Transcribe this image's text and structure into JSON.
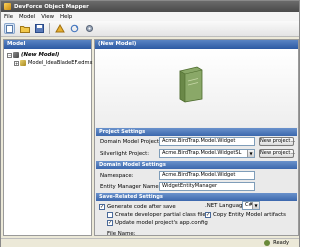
{
  "window": {
    "title": "DevForce Object Mapper"
  },
  "menu": [
    "File",
    "Model",
    "View",
    "Help"
  ],
  "left_panel": {
    "header": "Model",
    "tree": [
      {
        "label": "(New Model)",
        "expanded": true
      },
      {
        "label": "Model_IdeaBladeEF.edmx",
        "expanded": false
      }
    ]
  },
  "right_panel": {
    "header": "(New Model)",
    "project_settings": {
      "title": "Project Settings",
      "domain_label": "Domain Model Project:",
      "domain_value": "Acme.BirdTrap.Model.Widget",
      "domain_button": "New project...",
      "silverlight_label": "Silverlight Project:",
      "silverlight_value": "Acme.BirdTrap.Model.WidgetSL",
      "silverlight_button": "New project..."
    },
    "domain_settings": {
      "title": "Domain Model Settings",
      "namespace_label": "Namespace:",
      "namespace_value": "Acme.BirdTrap.Model.Widget",
      "manager_label": "Entity Manager Name:",
      "manager_value": "WidgetEntityManager"
    },
    "save_settings": {
      "title": "Save-Related Settings",
      "gen_after_save": {
        "label": "Generate code after save",
        "checked": true
      },
      "partial_files": {
        "label": "Create developer partial class files",
        "checked": false
      },
      "update_config": {
        "label": "Update model project's app.config",
        "checked": true
      },
      "language_label": ".NET Language:",
      "language_value": "C#",
      "copy_artifacts": {
        "label": "Copy Entity Model artifacts",
        "checked": true
      },
      "file_name_label": "File Name:"
    }
  },
  "status": {
    "text": "Ready"
  },
  "colors": {
    "accent": "#3c68ad",
    "title_bar": "#4a4a4a",
    "panel_bg": "#eaeaea"
  }
}
